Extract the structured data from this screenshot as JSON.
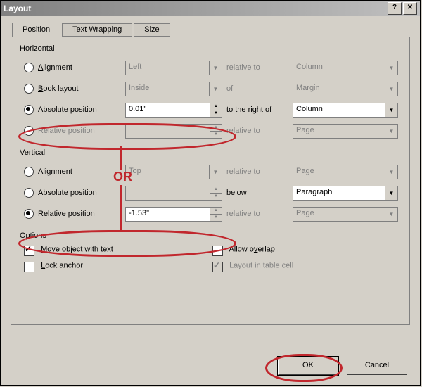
{
  "window": {
    "title": "Layout"
  },
  "tabs": {
    "position": "Position",
    "wrapping": "Text Wrapping",
    "size": "Size"
  },
  "groups": {
    "horizontal": "Horizontal",
    "vertical": "Vertical",
    "options": "Options"
  },
  "horiz": {
    "alignment_lbl": "Alignment",
    "alignment_val": "Left",
    "alignment_rel": "relative to",
    "alignment_rel_val": "Column",
    "book_lbl": "Book layout",
    "book_val": "Inside",
    "book_rel": "of",
    "book_rel_val": "Margin",
    "abs_lbl": "Absolute position",
    "abs_val": "0.01\"",
    "abs_rel": "to the right of",
    "abs_rel_val": "Column",
    "relpos_lbl": "Relative position",
    "relpos_val": "",
    "relpos_rel": "relative to",
    "relpos_rel_val": "Page"
  },
  "vert": {
    "alignment_lbl": "Alignment",
    "alignment_val": "Top",
    "alignment_rel": "relative to",
    "alignment_rel_val": "Page",
    "abs_lbl": "Absolute position",
    "abs_val": "",
    "abs_rel": "below",
    "abs_rel_val": "Paragraph",
    "relpos_lbl": "Relative position",
    "relpos_val": "-1.53\"",
    "relpos_rel": "relative to",
    "relpos_rel_val": "Page"
  },
  "options": {
    "move": "Move object with text",
    "overlap": "Allow overlap",
    "lock": "Lock anchor",
    "tablecell": "Layout in table cell"
  },
  "buttons": {
    "ok": "OK",
    "cancel": "Cancel"
  },
  "annotation": {
    "or": "OR"
  }
}
